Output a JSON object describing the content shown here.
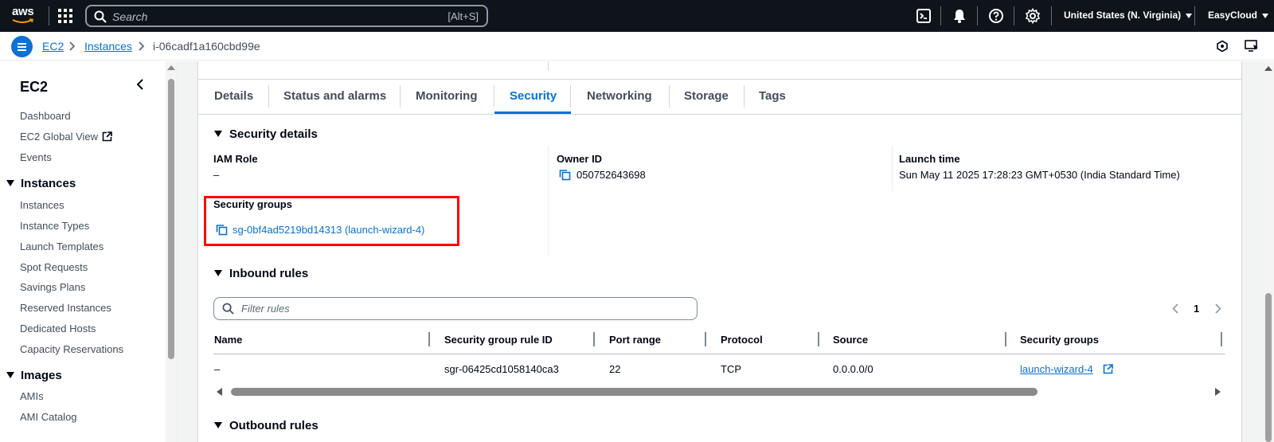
{
  "topnav": {
    "logo_text": "aws",
    "search_placeholder": "Search",
    "search_shortcut": "[Alt+S]",
    "region": "United States (N. Virginia)",
    "account": "EasyCloud",
    "icons": [
      "cloudshell-icon",
      "notifications-bell-icon",
      "help-icon",
      "settings-gear-icon"
    ]
  },
  "breadcrumb": {
    "items": [
      "EC2",
      "Instances"
    ],
    "current": "i-06cadf1a160cbd99e"
  },
  "sidebar": {
    "title": "EC2",
    "top_items": [
      "Dashboard",
      "EC2 Global View",
      "Events"
    ],
    "sections": [
      {
        "title": "Instances",
        "items": [
          "Instances",
          "Instance Types",
          "Launch Templates",
          "Spot Requests",
          "Savings Plans",
          "Reserved Instances",
          "Dedicated Hosts",
          "Capacity Reservations"
        ]
      },
      {
        "title": "Images",
        "items": [
          "AMIs",
          "AMI Catalog"
        ]
      }
    ]
  },
  "tabs": [
    "Details",
    "Status and alarms",
    "Monitoring",
    "Security",
    "Networking",
    "Storage",
    "Tags"
  ],
  "active_tab": "Security",
  "security_details": {
    "heading": "Security details",
    "iam_role_label": "IAM Role",
    "iam_role_value": "–",
    "owner_id_label": "Owner ID",
    "owner_id_value": "050752643698",
    "launch_time_label": "Launch time",
    "launch_time_value": "Sun May 11 2025 17:28:23 GMT+0530 (India Standard Time)",
    "security_groups_label": "Security groups",
    "security_groups_value": "sg-0bf4ad5219bd14313 (launch-wizard-4)"
  },
  "inbound": {
    "heading": "Inbound rules",
    "filter_placeholder": "Filter rules",
    "page": "1",
    "columns": [
      "Name",
      "Security group rule ID",
      "Port range",
      "Protocol",
      "Source",
      "Security groups"
    ],
    "rows": [
      {
        "name": "–",
        "rule_id": "sgr-06425cd1058140ca3",
        "port_range": "22",
        "protocol": "TCP",
        "source": "0.0.0.0/0",
        "security_group": "launch-wizard-4"
      }
    ]
  },
  "outbound": {
    "heading": "Outbound rules"
  },
  "colors": {
    "accent": "#0972d3",
    "nav_bg": "#0f141a",
    "highlight": "#ff0000"
  }
}
